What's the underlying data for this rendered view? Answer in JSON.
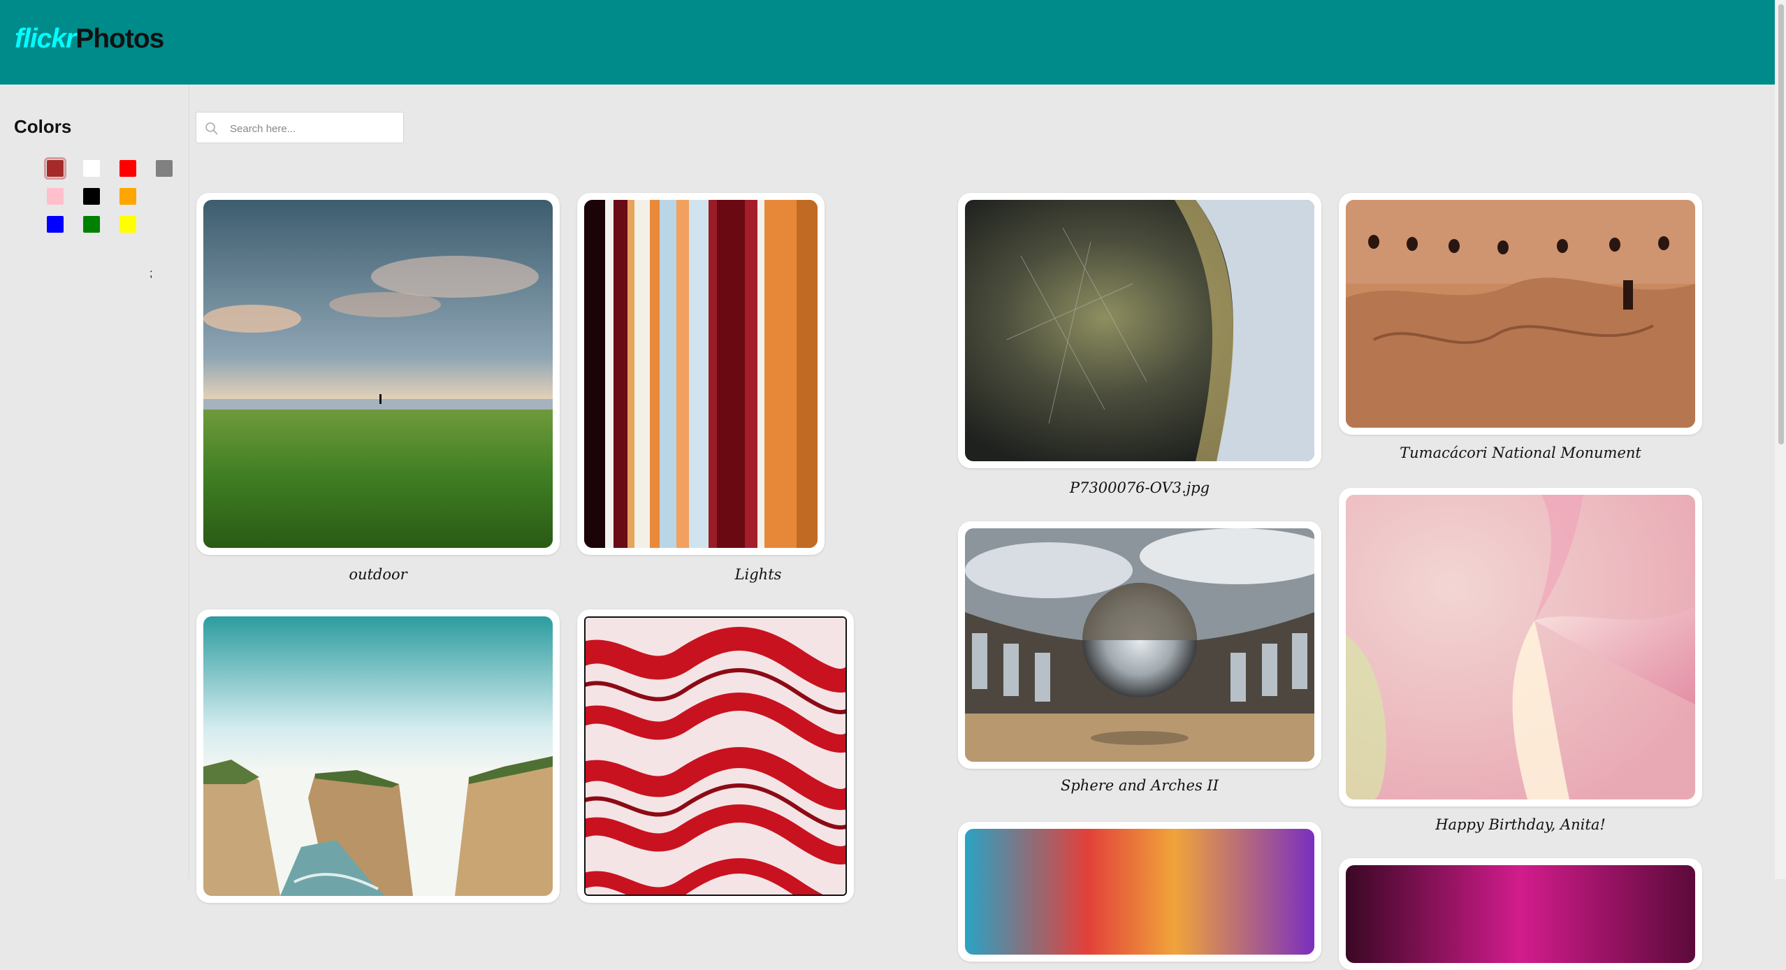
{
  "header": {
    "logo_prefix": "flickr",
    "logo_suffix": "Photos"
  },
  "sidebar": {
    "title": "Colors",
    "swatches": [
      {
        "name": "brown",
        "hex": "#a52a2a",
        "selected": true
      },
      {
        "name": "white",
        "hex": "#ffffff"
      },
      {
        "name": "red",
        "hex": "#ff0000"
      },
      {
        "name": "gray",
        "hex": "#808080"
      },
      {
        "name": "pink",
        "hex": "#ffc0cb"
      },
      {
        "name": "black",
        "hex": "#000000"
      },
      {
        "name": "orange",
        "hex": "#ffa500"
      },
      {
        "name": "blue",
        "hex": "#0000ff"
      },
      {
        "name": "green",
        "hex": "#008000"
      },
      {
        "name": "yellow",
        "hex": "#ffff00"
      }
    ],
    "stray_text": ";"
  },
  "search": {
    "placeholder": "Search here..."
  },
  "photos": [
    {
      "caption": "outdoor"
    },
    {
      "caption": "Lights"
    },
    {
      "caption": "P7300076-OV3.jpg"
    },
    {
      "caption": "Tumacácori National Monument"
    },
    {
      "caption": "Sphere and Arches II"
    },
    {
      "caption": "Happy Birthday, Anita!"
    },
    {
      "caption": ""
    },
    {
      "caption": ""
    },
    {
      "caption": ""
    },
    {
      "caption": ""
    }
  ]
}
